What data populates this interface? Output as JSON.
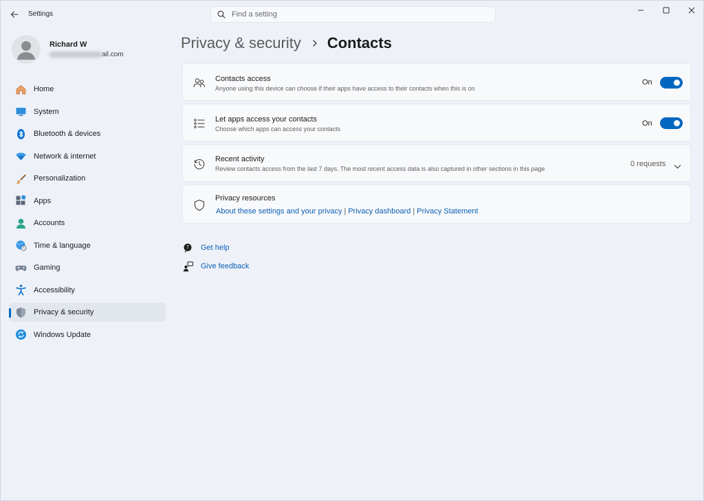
{
  "window": {
    "title": "Settings"
  },
  "search": {
    "placeholder": "Find a setting"
  },
  "profile": {
    "name": "Richard W",
    "email_suffix": "ail.com"
  },
  "sidebar": {
    "items": [
      {
        "label": "Home",
        "icon": "home-icon"
      },
      {
        "label": "System",
        "icon": "system-icon"
      },
      {
        "label": "Bluetooth & devices",
        "icon": "bluetooth-icon"
      },
      {
        "label": "Network & internet",
        "icon": "wifi-icon"
      },
      {
        "label": "Personalization",
        "icon": "brush-icon"
      },
      {
        "label": "Apps",
        "icon": "apps-icon"
      },
      {
        "label": "Accounts",
        "icon": "accounts-icon"
      },
      {
        "label": "Time & language",
        "icon": "globe-clock-icon"
      },
      {
        "label": "Gaming",
        "icon": "gamepad-icon"
      },
      {
        "label": "Accessibility",
        "icon": "accessibility-icon"
      },
      {
        "label": "Privacy & security",
        "icon": "shield-icon",
        "active": true
      },
      {
        "label": "Windows Update",
        "icon": "update-icon"
      }
    ]
  },
  "breadcrumb": {
    "parent": "Privacy & security",
    "current": "Contacts"
  },
  "cards": {
    "contacts_access": {
      "title": "Contacts access",
      "description": "Anyone using this device can choose if their apps have access to their contacts when this is on",
      "state_label": "On",
      "enabled": true
    },
    "app_access": {
      "title": "Let apps access your contacts",
      "description": "Choose which apps can access your contacts",
      "state_label": "On",
      "enabled": true
    },
    "recent_activity": {
      "title": "Recent activity",
      "description": "Review contacts access from the last 7 days. The most recent access data is also captured in other sections in this page",
      "requests": "0 requests"
    },
    "privacy_resources": {
      "title": "Privacy resources",
      "links": [
        "About these settings and your privacy",
        "Privacy dashboard",
        "Privacy Statement"
      ]
    }
  },
  "help": {
    "get_help": "Get help",
    "give_feedback": "Give feedback"
  },
  "colors": {
    "accent": "#0067c0",
    "link": "#0a5fb4",
    "background": "#eef2f8",
    "card": "#f8f9fb"
  }
}
